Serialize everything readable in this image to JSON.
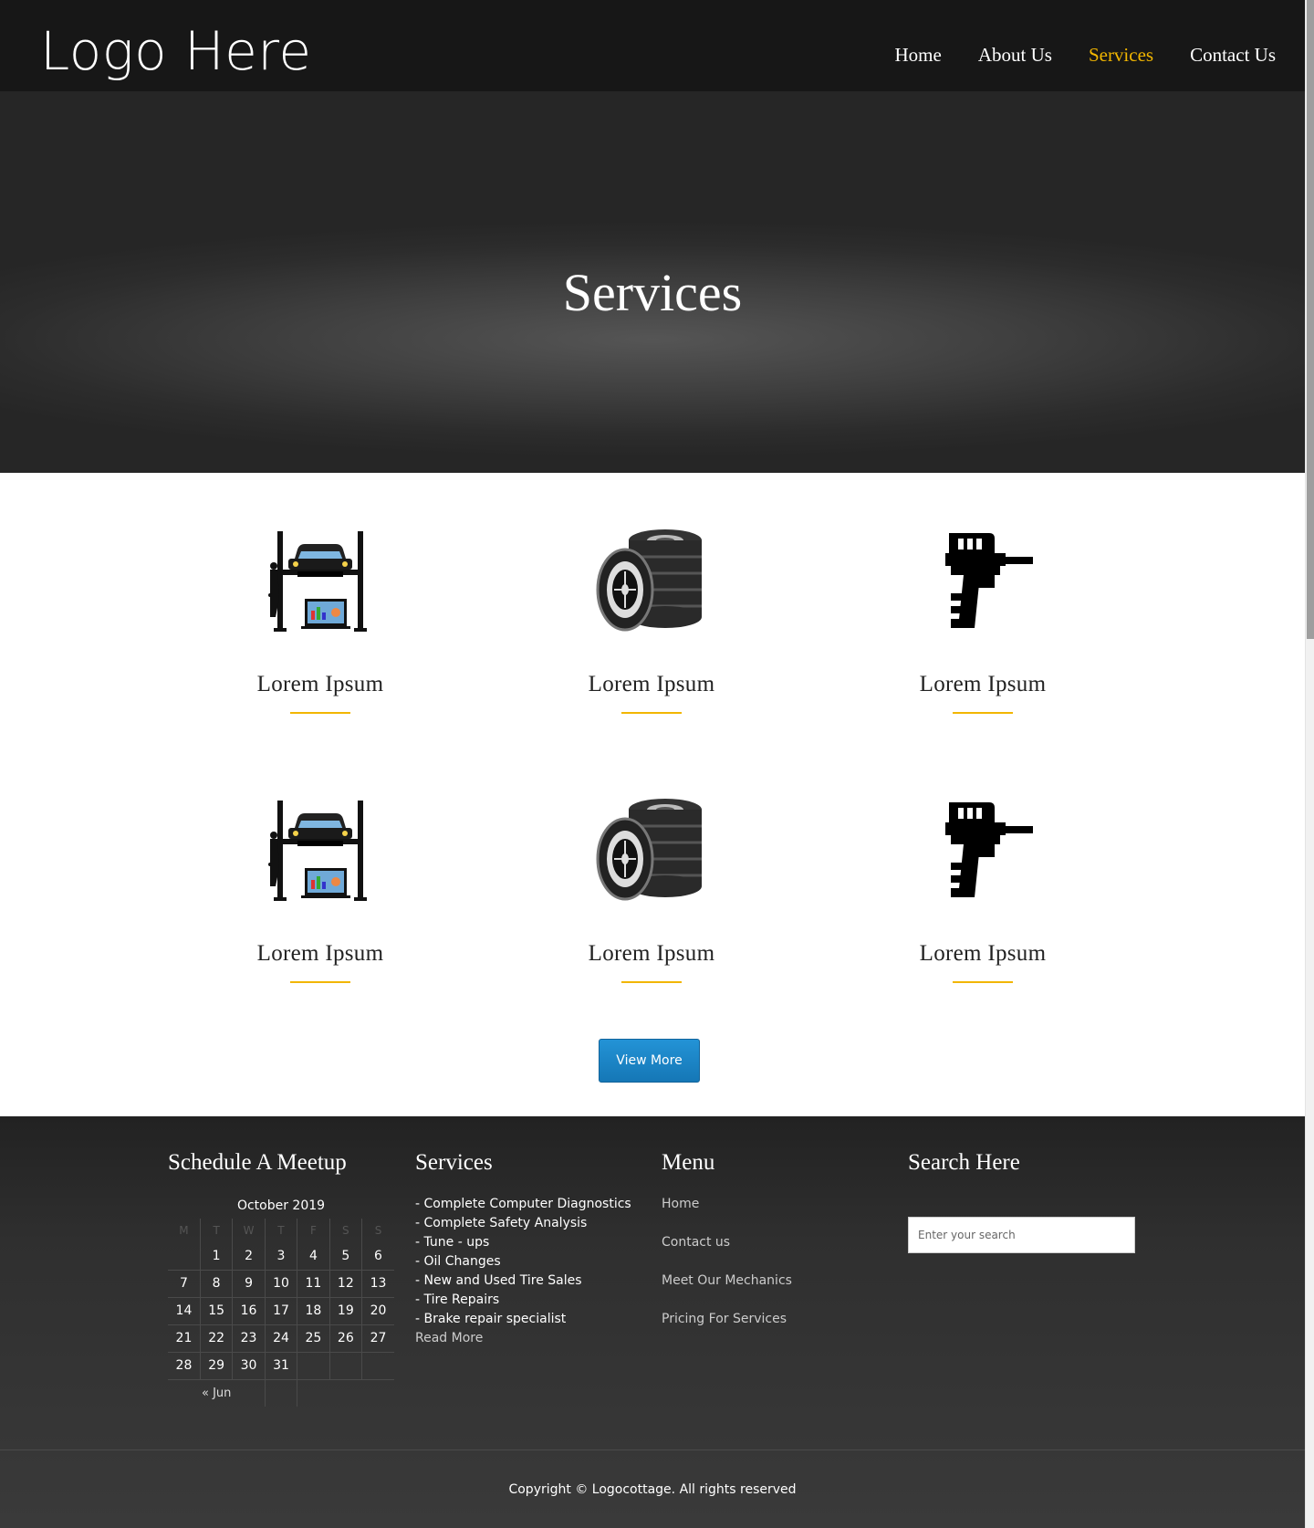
{
  "header": {
    "logo": "Logo Here",
    "nav": [
      {
        "label": "Home",
        "active": false
      },
      {
        "label": "About Us",
        "active": false
      },
      {
        "label": "Services",
        "active": true
      },
      {
        "label": "Contact Us",
        "active": false
      }
    ]
  },
  "hero": {
    "title": "Services"
  },
  "services": {
    "items": [
      {
        "label": "Lorem Ipsum",
        "icon": "car-lift-icon"
      },
      {
        "label": "Lorem Ipsum",
        "icon": "tire-stack-icon"
      },
      {
        "label": "Lorem Ipsum",
        "icon": "impact-wrench-icon"
      },
      {
        "label": "Lorem Ipsum",
        "icon": "car-lift-icon"
      },
      {
        "label": "Lorem Ipsum",
        "icon": "tire-stack-icon"
      },
      {
        "label": "Lorem Ipsum",
        "icon": "impact-wrench-icon"
      }
    ],
    "view_more_label": "View More"
  },
  "footer": {
    "schedule": {
      "title": "Schedule A Meetup",
      "calendar_caption": "October 2019",
      "weekdays": [
        "M",
        "T",
        "W",
        "T",
        "F",
        "S",
        "S"
      ],
      "weeks": [
        [
          "",
          "1",
          "2",
          "3",
          "4",
          "5",
          "6"
        ],
        [
          "7",
          "8",
          "9",
          "10",
          "11",
          "12",
          "13"
        ],
        [
          "14",
          "15",
          "16",
          "17",
          "18",
          "19",
          "20"
        ],
        [
          "21",
          "22",
          "23",
          "24",
          "25",
          "26",
          "27"
        ],
        [
          "28",
          "29",
          "30",
          "31",
          "",
          "",
          ""
        ]
      ],
      "prev_link": "« Jun"
    },
    "services": {
      "title": "Services",
      "items": [
        "- Complete Computer Diagnostics",
        "- Complete Safety Analysis",
        "- Tune - ups",
        "- Oil Changes",
        "- New and Used Tire Sales",
        "- Tire Repairs",
        "- Brake repair specialist"
      ],
      "read_more": "Read More"
    },
    "menu": {
      "title": "Menu",
      "items": [
        "Home",
        "Contact us",
        "Meet Our Mechanics",
        "Pricing For Services"
      ]
    },
    "search": {
      "title": "Search Here",
      "placeholder": "Enter your search"
    },
    "copyright": "Copyright © Logocottage. All rights reserved"
  },
  "colors": {
    "accent": "#f2b600",
    "button": "#1a85c8",
    "header_bg": "#171717",
    "footer_bg": "#333333"
  }
}
